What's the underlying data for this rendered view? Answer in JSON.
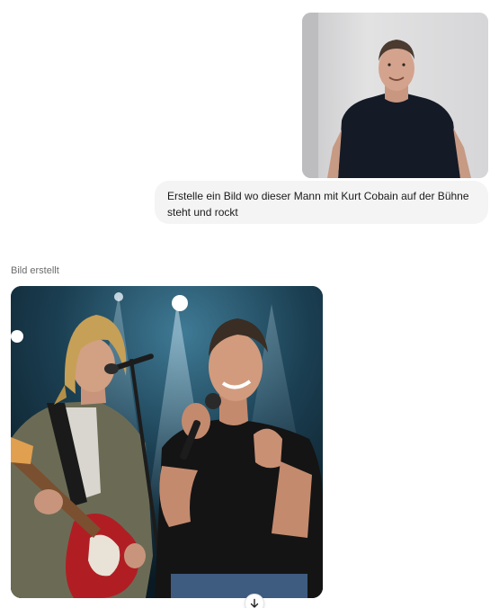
{
  "chat": {
    "user_message": "Erstelle ein Bild wo dieser Mann mit Kurt Cobain auf der Bühne steht und rockt",
    "status_label": "Bild erstellt"
  },
  "icons": {
    "download": "arrow-down-icon"
  }
}
